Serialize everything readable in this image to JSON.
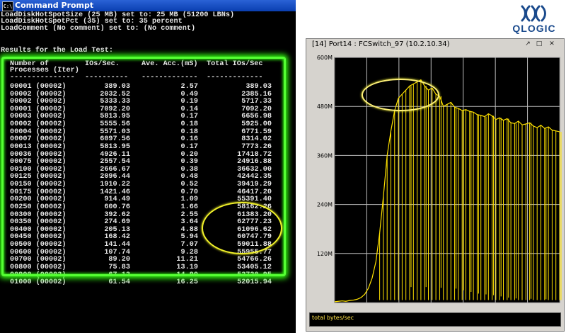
{
  "cmd": {
    "title": "Command Prompt",
    "icon": "cmd-icon",
    "header_lines": [
      "LoadDiskHotSpotSize (25 MB) set to: 25 MB (51200 LBNs)",
      "LoadDiskHotSpotPct (35) set to: 35 percent",
      "LoadComment (No comment) set to: (No comment)",
      "",
      "Results for the Load Test:"
    ],
    "table_headers": [
      [
        "Number of",
        "Processes (Iter)"
      ],
      [
        "IOs/Sec."
      ],
      [
        "Ave. Acc.(mS)"
      ],
      [
        "Total IOs/Sec"
      ]
    ],
    "table_rule": [
      "---------------",
      "----------",
      "-------------",
      "-------------"
    ],
    "rows": [
      [
        "00001 (00002)",
        "389.03",
        "2.57",
        "389.03"
      ],
      [
        "00002 (00002)",
        "2032.52",
        "0.49",
        "2385.16"
      ],
      [
        "00002 (00002)",
        "5333.33",
        "0.19",
        "5717.33"
      ],
      [
        "00001 (00002)",
        "7092.20",
        "0.14",
        "7092.20"
      ],
      [
        "00003 (00002)",
        "5813.95",
        "0.17",
        "6656.98"
      ],
      [
        "00002 (00002)",
        "5555.56",
        "0.18",
        "5925.00"
      ],
      [
        "00004 (00002)",
        "5571.03",
        "0.18",
        "6771.59"
      ],
      [
        "00007 (00002)",
        "6097.56",
        "0.16",
        "8314.02"
      ],
      [
        "00013 (00002)",
        "5813.95",
        "0.17",
        "7773.26"
      ],
      [
        "00036 (00002)",
        "4926.11",
        "0.20",
        "17418.72"
      ],
      [
        "00075 (00002)",
        "2557.54",
        "0.39",
        "24916.88"
      ],
      [
        "00100 (00002)",
        "2666.67",
        "0.38",
        "36632.00"
      ],
      [
        "00125 (00002)",
        "2096.44",
        "0.48",
        "42442.35"
      ],
      [
        "00150 (00002)",
        "1910.22",
        "0.52",
        "39419.29"
      ],
      [
        "00175 (00002)",
        "1421.46",
        "0.70",
        "46417.20"
      ],
      [
        "00200 (00002)",
        "914.49",
        "1.09",
        "55391.40"
      ],
      [
        "00250 (00002)",
        "600.76",
        "1.66",
        "58162.26"
      ],
      [
        "00300 (00002)",
        "392.62",
        "2.55",
        "61383.20"
      ],
      [
        "00350 (00002)",
        "274.69",
        "3.64",
        "62777.23"
      ],
      [
        "00400 (00002)",
        "205.13",
        "4.88",
        "61096.62"
      ],
      [
        "00450 (00002)",
        "168.42",
        "5.94",
        "60747.79"
      ],
      [
        "00500 (00002)",
        "141.44",
        "7.07",
        "59011.88"
      ],
      [
        "00600 (00002)",
        "107.74",
        "9.28",
        "55955.77"
      ],
      [
        "00700 (00002)",
        "89.20",
        "11.21",
        "54766.26"
      ],
      [
        "00800 (00002)",
        "75.83",
        "13.19",
        "53405.12"
      ],
      [
        "00900 (00002)",
        "67.12",
        "14.90",
        "52720.95"
      ],
      [
        "01000 (00002)",
        "61.54",
        "16.25",
        "52015.94"
      ]
    ]
  },
  "brand": {
    "name": "QLOGIC",
    "logo_icon": "qlogic-logo-icon",
    "color": "#1a4a8c"
  },
  "chart_window": {
    "title": "[14] Port14 : FCSwitch_97 (10.2.10.34)",
    "buttons": [
      "↗",
      "□",
      "✕"
    ],
    "status_label": "total bytes/sec"
  },
  "chart_data": {
    "type": "area",
    "ylabels": [
      "600M",
      "480M",
      "360M",
      "240M",
      "120M"
    ],
    "ylim": [
      0,
      600
    ],
    "grid": true,
    "line_color": "#ffe200",
    "background": "#000000",
    "x": [
      0,
      1,
      2,
      3,
      4,
      5,
      6,
      7,
      8,
      9,
      10,
      11,
      12,
      13,
      14,
      15,
      16,
      17,
      18,
      19,
      20,
      21,
      22,
      23,
      24,
      25,
      26,
      27,
      28,
      29,
      30,
      31,
      32,
      33,
      34,
      35,
      36,
      37,
      38,
      39,
      40,
      41,
      42,
      43,
      44,
      45,
      46,
      47,
      48,
      49,
      50,
      51,
      52,
      53,
      54,
      55,
      56,
      57,
      58,
      59,
      60
    ],
    "values": [
      2,
      3,
      4,
      3,
      5,
      6,
      8,
      12,
      20,
      35,
      60,
      100,
      170,
      260,
      360,
      420,
      470,
      500,
      510,
      520,
      530,
      535,
      540,
      545,
      530,
      520,
      525,
      510,
      505,
      480,
      485,
      490,
      478,
      475,
      470,
      472,
      468,
      466,
      460,
      458,
      455,
      462,
      457,
      448,
      452,
      446,
      450,
      440,
      438,
      444,
      435,
      437,
      440,
      432,
      428,
      434,
      426,
      430,
      422,
      420,
      418
    ],
    "dropouts": [
      [
        20,
        38
      ],
      [
        24,
        38
      ],
      [
        28,
        36
      ],
      [
        32,
        34
      ],
      [
        34,
        30
      ],
      [
        36,
        26
      ],
      [
        38,
        22
      ],
      [
        40,
        20
      ],
      [
        42,
        18
      ],
      [
        44,
        15
      ],
      [
        46,
        12
      ],
      [
        48,
        10
      ],
      [
        52,
        9
      ],
      [
        56,
        8
      ],
      [
        60,
        6
      ]
    ]
  }
}
